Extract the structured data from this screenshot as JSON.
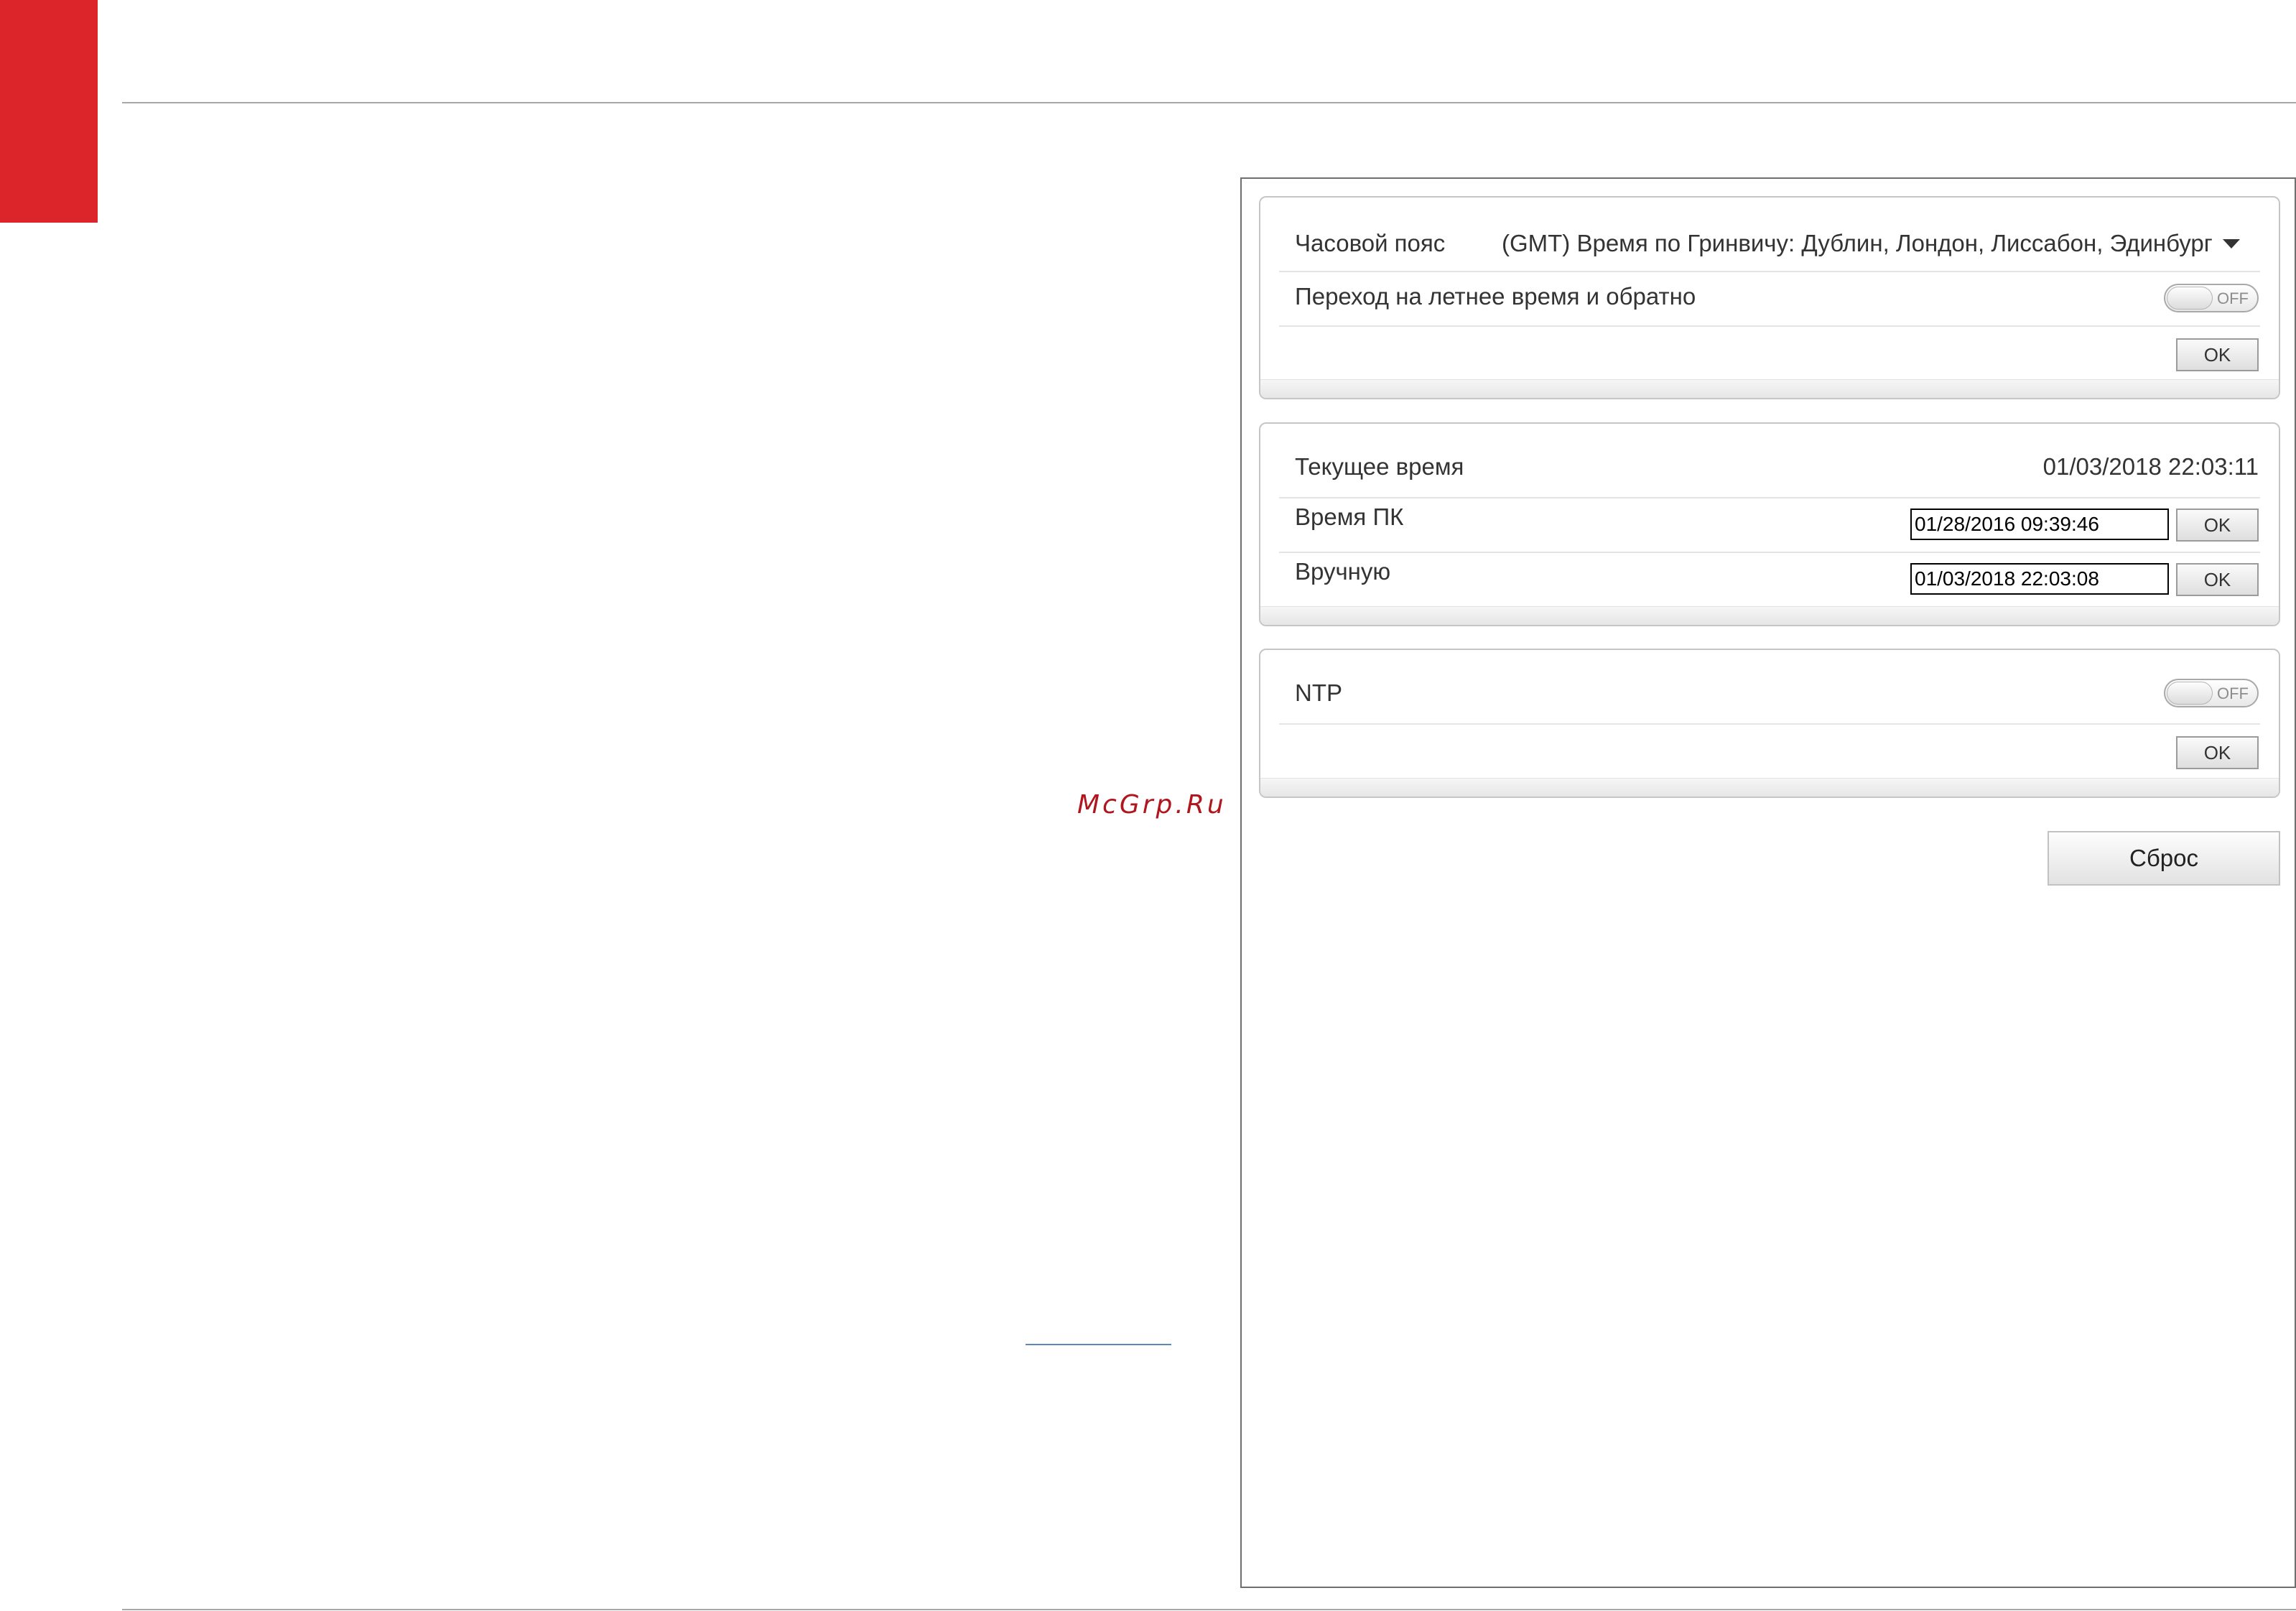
{
  "watermark": "McGrp.Ru",
  "timezone_panel": {
    "timezone_label": "Часовой пояс",
    "timezone_value": "(GMT) Время по Гринвичу: Дублин, Лондон, Лиссабон, Эдинбург",
    "dst_label": "Переход на летнее время и обратно",
    "dst_toggle": "OFF",
    "ok_label": "OK"
  },
  "time_panel": {
    "current_time_label": "Текущее время",
    "current_time_value": "01/03/2018 22:03:11",
    "pc_time_label": "Время ПК",
    "pc_time_value": "01/28/2016 09:39:46",
    "pc_time_ok": "OK",
    "manual_label": "Вручную",
    "manual_value": "01/03/2018 22:03:08",
    "manual_ok": "OK"
  },
  "ntp_panel": {
    "ntp_label": "NTP",
    "ntp_toggle": "OFF",
    "ok_label": "OK"
  },
  "reset_label": "Сброс"
}
